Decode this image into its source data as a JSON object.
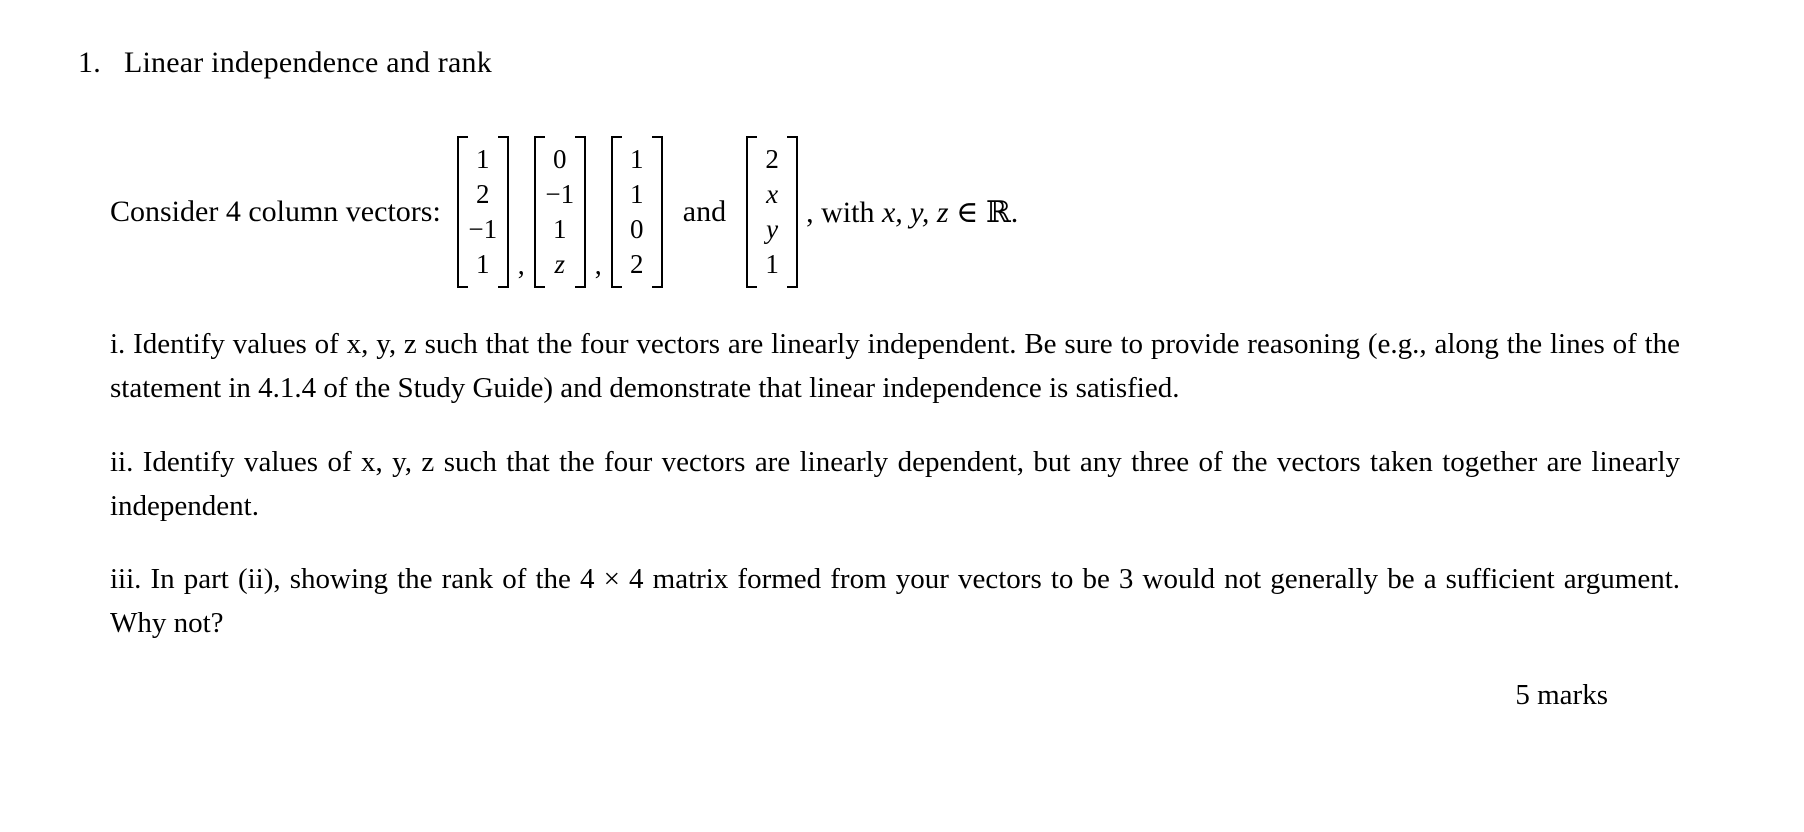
{
  "question": {
    "number": "1.",
    "title": "Linear independence and rank"
  },
  "consider": {
    "lead": "Consider 4 column vectors:",
    "separator": ",",
    "conjunction": "and",
    "tail": ", with ",
    "tail_vars": "x, y, z",
    "tail_member": " ∈ ",
    "tail_set": "ℝ",
    "tail_end": "."
  },
  "vectors": [
    {
      "name": "vector-1",
      "entries": [
        "1",
        "2",
        "−1",
        "1"
      ],
      "italic": [
        false,
        false,
        false,
        false
      ]
    },
    {
      "name": "vector-2",
      "entries": [
        "0",
        "−1",
        "1",
        "z"
      ],
      "italic": [
        false,
        false,
        false,
        true
      ]
    },
    {
      "name": "vector-3",
      "entries": [
        "1",
        "1",
        "0",
        "2"
      ],
      "italic": [
        false,
        false,
        false,
        false
      ]
    },
    {
      "name": "vector-4",
      "entries": [
        "2",
        "x",
        "y",
        "1"
      ],
      "italic": [
        false,
        true,
        true,
        false
      ]
    }
  ],
  "subparts": [
    {
      "label": "i.",
      "text": "i. Identify values of x, y, z such that the four vectors are linearly independent. Be sure to provide reasoning (e.g., along the lines of the statement in 4.1.4 of the Study Guide) and demonstrate that linear independence is satisfied."
    },
    {
      "label": "ii.",
      "text": "ii. Identify values of x, y, z such that the four vectors are linearly dependent, but any three of the vectors taken together are linearly independent."
    },
    {
      "label": "iii.",
      "text": "iii. In part (ii), showing the rank of the 4 × 4 matrix formed from your vectors to be 3 would not generally be a sufficient argument. Why not?"
    }
  ],
  "marks": "5 marks"
}
